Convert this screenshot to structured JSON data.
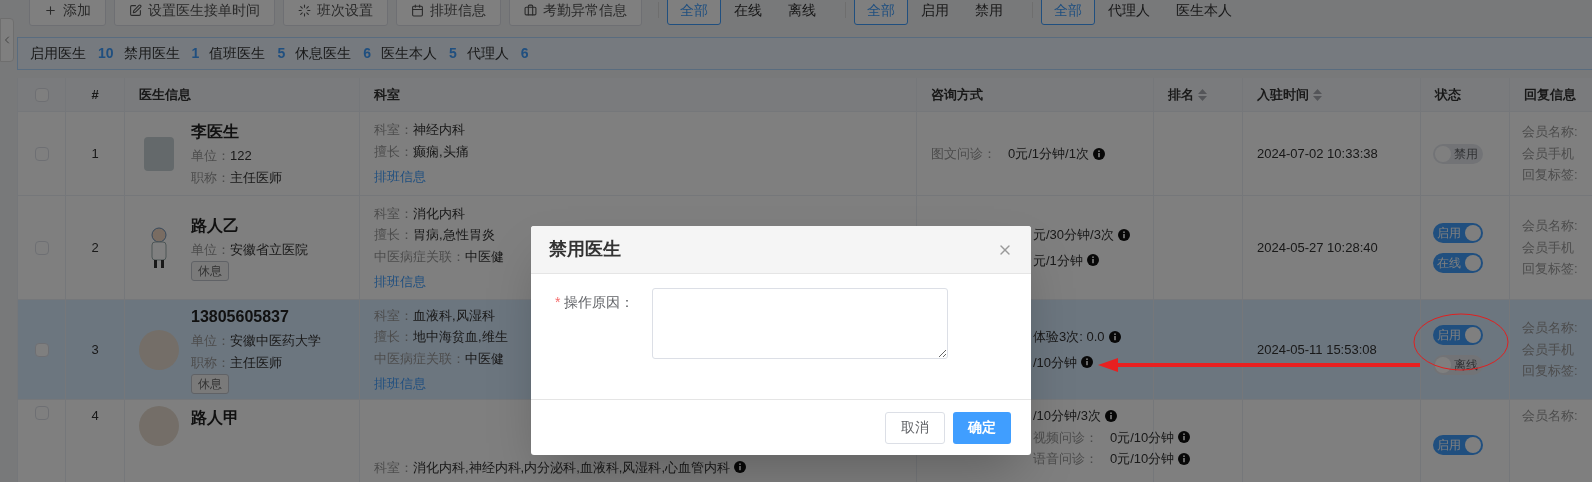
{
  "toolbar": {
    "buttons": [
      {
        "label": "添加"
      },
      {
        "label": "设置医生接单时间"
      },
      {
        "label": "班次设置"
      },
      {
        "label": "排班信息"
      },
      {
        "label": "考勤异常信息"
      }
    ],
    "filters": [
      {
        "options": [
          {
            "label": "全部",
            "selected": true
          },
          {
            "label": "在线",
            "selected": false
          },
          {
            "label": "离线",
            "selected": false
          }
        ]
      },
      {
        "options": [
          {
            "label": "全部",
            "selected": true
          },
          {
            "label": "启用",
            "selected": false
          },
          {
            "label": "禁用",
            "selected": false
          }
        ]
      },
      {
        "options": [
          {
            "label": "全部",
            "selected": true
          },
          {
            "label": "代理人",
            "selected": false
          },
          {
            "label": "医生本人",
            "selected": false
          }
        ]
      }
    ]
  },
  "stats": [
    {
      "label": "启用医生",
      "count": "10"
    },
    {
      "label": "禁用医生",
      "count": "1"
    },
    {
      "label": "值班医生",
      "count": "5"
    },
    {
      "label": "休息医生",
      "count": "6"
    },
    {
      "label": "医生本人",
      "count": "5"
    },
    {
      "label": "代理人",
      "count": "6"
    }
  ],
  "table": {
    "all_checked": false,
    "columns": [
      "#",
      "医生信息",
      "科室",
      "咨询方式",
      "排名",
      "入驻时间",
      "状态",
      "回复信息"
    ],
    "rows": [
      {
        "selected": false,
        "checked": false,
        "number": "1",
        "avatar": {
          "kind": "square"
        },
        "name": "李医生",
        "info": [
          {
            "label": "单位：",
            "value": "122"
          },
          {
            "label": "职称：",
            "value": "主任医师"
          }
        ],
        "dept": [
          {
            "label": "科室：",
            "value": "神经内科"
          },
          {
            "label": "擅长：",
            "value": "癫痫,头痛"
          }
        ],
        "schedule_link": "排班信息",
        "consult": [
          {
            "label": "图文问诊：",
            "value": "0元/1分钟/1次"
          }
        ],
        "joined": "2024-07-02 10:33:38",
        "switches": [
          {
            "label": "禁用",
            "on": false
          }
        ],
        "reply": [
          "会员名称:",
          "会员手机",
          "回复标签:"
        ]
      },
      {
        "selected": false,
        "checked": false,
        "number": "2",
        "avatar": {
          "kind": "figure"
        },
        "name": "路人乙",
        "info": [
          {
            "label": "单位：",
            "value": "安徽省立医院"
          }
        ],
        "tag": "休息",
        "dept": [
          {
            "label": "科室：",
            "value": "消化内科"
          },
          {
            "label": "擅长：",
            "value": "胃病,急性胃炎"
          },
          {
            "label": "中医病症关联：",
            "value": "中医健"
          }
        ],
        "schedule_link": "排班信息",
        "consult_covered": true,
        "consult": [
          {
            "value": "元/30分钟/3次"
          },
          {
            "value": "元/1分钟"
          }
        ],
        "joined": "2024-05-27 10:28:40",
        "switches": [
          {
            "label": "启用",
            "on": true
          },
          {
            "label": "在线",
            "on": true
          }
        ],
        "reply": [
          "会员名称:",
          "会员手机",
          "回复标签:"
        ]
      },
      {
        "selected": true,
        "checked": false,
        "number": "3",
        "avatar": {
          "kind": "round"
        },
        "name": "13805605837",
        "info": [
          {
            "label": "单位：",
            "value": "安徽中医药大学"
          },
          {
            "label": "职称：",
            "value": "主任医师"
          }
        ],
        "tag": "休息",
        "dept": [
          {
            "label": "科室：",
            "value": "血液科,风湿科"
          },
          {
            "label": "擅长：",
            "value": "地中海贫血,维生"
          },
          {
            "label": "中医病症关联：",
            "value": "中医健"
          }
        ],
        "schedule_link": "排班信息",
        "consult_covered": true,
        "consult": [
          {
            "value": "体验3次: 0.0"
          },
          {
            "value": "/10分钟"
          }
        ],
        "joined": "2024-05-11 15:53:08",
        "switches": [
          {
            "label": "启用",
            "on": true
          },
          {
            "label": "离线",
            "on": false
          }
        ],
        "reply": [
          "会员名称:",
          "会员手机",
          "回复标签:"
        ]
      },
      {
        "selected": false,
        "checked": false,
        "number": "4",
        "avatar": {
          "kind": "round"
        },
        "name": "路人甲",
        "info": [],
        "dept": [
          {
            "label": "科室：",
            "value": "消化内科,神经内科,内分泌科,血液科,风湿科,心血管内科",
            "info": true
          }
        ],
        "consult_covered": true,
        "consult": [
          {
            "value": "/10分钟/3次"
          },
          {
            "label": "视频问诊：",
            "value": "0元/10分钟"
          },
          {
            "label": "语音问诊：",
            "value": "0元/10分钟"
          }
        ],
        "joined": "",
        "switches": [
          {
            "label": "启用",
            "on": true
          }
        ],
        "reply": [
          "会员名称:"
        ]
      }
    ]
  },
  "dialog": {
    "title": "禁用医生",
    "field": {
      "required": true,
      "required_mark": "*",
      "label": "操作原因："
    },
    "buttons": [
      {
        "label": "取消",
        "kind": "secondary"
      },
      {
        "label": "确定",
        "kind": "primary"
      }
    ]
  }
}
